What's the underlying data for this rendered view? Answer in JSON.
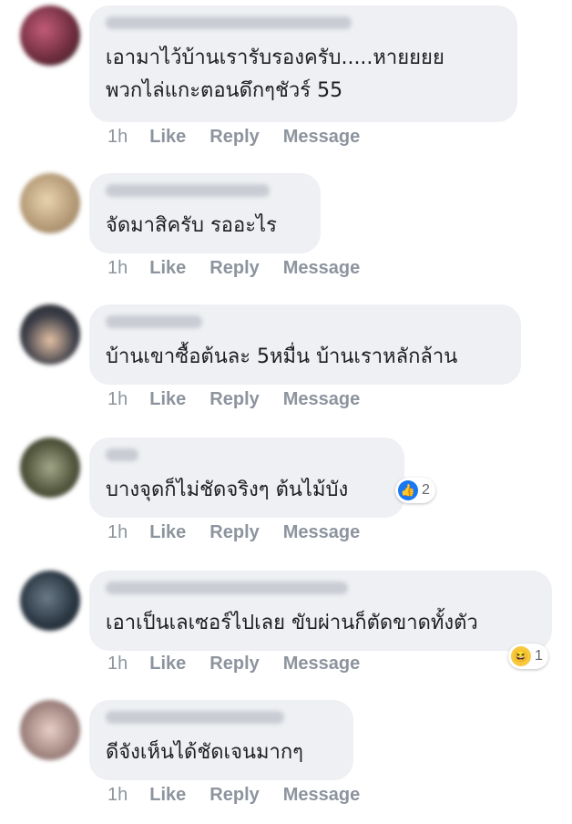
{
  "comments": [
    {
      "text1": "เอามาไว้บ้านเรารับรองครับ.....หายยยย",
      "text2": "พวกไล่แกะตอนดึกๆชัวร์ 55",
      "time": "1h",
      "like": "Like",
      "reply": "Reply",
      "message": "Message",
      "avatar_color": "#7a3a4a"
    },
    {
      "text1": "จัดมาสิครับ รออะไร",
      "time": "1h",
      "like": "Like",
      "reply": "Reply",
      "message": "Message",
      "avatar_color": "#c9b48f"
    },
    {
      "text1": "บ้านเขาซื้อต้นละ 5หมื่น บ้านเราหลักล้าน",
      "time": "1h",
      "like": "Like",
      "reply": "Reply",
      "message": "Message",
      "avatar_color": "#3b3f4a"
    },
    {
      "text1": "บางจุดก็ไม่ชัดจริงๆ ต้นไม้บัง",
      "time": "1h",
      "like": "Like",
      "reply": "Reply",
      "message": "Message",
      "avatar_color": "#5a5e44",
      "reaction": {
        "icon": "like-icon",
        "count": "2",
        "color": "#1877f2"
      }
    },
    {
      "text1": "เอาเป็นเลเซอร์ไปเลย ขับผ่านก็ตัดขาดทั้งตัว",
      "time": "1h",
      "like": "Like",
      "reply": "Reply",
      "message": "Message",
      "avatar_color": "#2d3a46",
      "reaction": {
        "icon": "haha-icon",
        "count": "1",
        "color": "#f7c93e"
      }
    },
    {
      "text1": "ดีจังเห็นได้ชัดเจนมากๆ",
      "time": "1h",
      "like": "Like",
      "reply": "Reply",
      "message": "Message",
      "avatar_color": "#a88b86"
    }
  ]
}
